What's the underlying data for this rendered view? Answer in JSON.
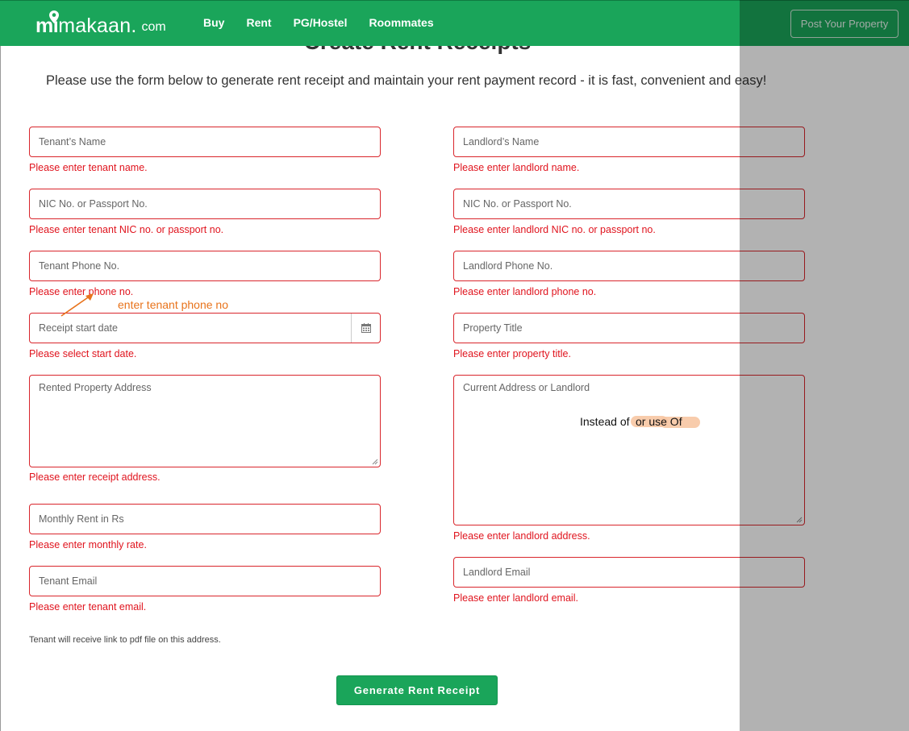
{
  "header": {
    "logo": {
      "part1": "mi",
      "part2": "makaan.",
      "part3": "com"
    },
    "nav": [
      "Buy",
      "Rent",
      "PG/Hostel",
      "Roommates"
    ],
    "post_button": "Post Your Property"
  },
  "page": {
    "title": "Create Rent Receipts",
    "intro": "Please use the form below to generate rent receipt and maintain your rent payment record - it is fast, convenient and easy!"
  },
  "form": {
    "tenant_name": {
      "placeholder": "Tenant’s Name",
      "error": "Please enter tenant name."
    },
    "tenant_nic": {
      "placeholder": "NIC No. or Passport No.",
      "error": "Please enter tenant NIC no. or passport no."
    },
    "tenant_phone": {
      "placeholder": "Tenant Phone No.",
      "error": "Please enter phone no."
    },
    "start_date": {
      "placeholder": "Receipt start date",
      "error": "Please select start date."
    },
    "property_address": {
      "placeholder": "Rented Property Address",
      "error": "Please enter receipt address."
    },
    "monthly_rent": {
      "placeholder": "Monthly Rent in Rs",
      "error": "Please enter monthly rate."
    },
    "tenant_email": {
      "placeholder": "Tenant Email",
      "error": "Please enter tenant email."
    },
    "landlord_name": {
      "placeholder": "Landlord’s Name",
      "error": "Please enter landlord name."
    },
    "landlord_nic": {
      "placeholder": "NIC No. or Passport No.",
      "error": "Please enter landlord NIC no. or passport no."
    },
    "landlord_phone": {
      "placeholder": "Landlord Phone No.",
      "error": "Please enter landlord phone no."
    },
    "property_title": {
      "placeholder": "Property Title",
      "error": "Please enter property title."
    },
    "landlord_address": {
      "placeholder": "Current Address or Landlord",
      "error": "Please enter landlord address."
    },
    "landlord_email": {
      "placeholder": "Landlord Email",
      "error": "Please enter landlord email."
    },
    "note": "Tenant will receive link to pdf file on this address.",
    "submit": "Generate Rent Receipt"
  },
  "annotations": {
    "phone_hint": "enter tenant phone no",
    "instead_of": "Instead of",
    "or_use_of": "or use Of"
  },
  "colors": {
    "brand_green": "#1aa55a",
    "error_red": "#e0141e",
    "annotation_orange": "#e8731b"
  },
  "icons": [
    "map-pin-icon",
    "calendar-icon",
    "resize-grip-icon",
    "arrow-icon"
  ]
}
